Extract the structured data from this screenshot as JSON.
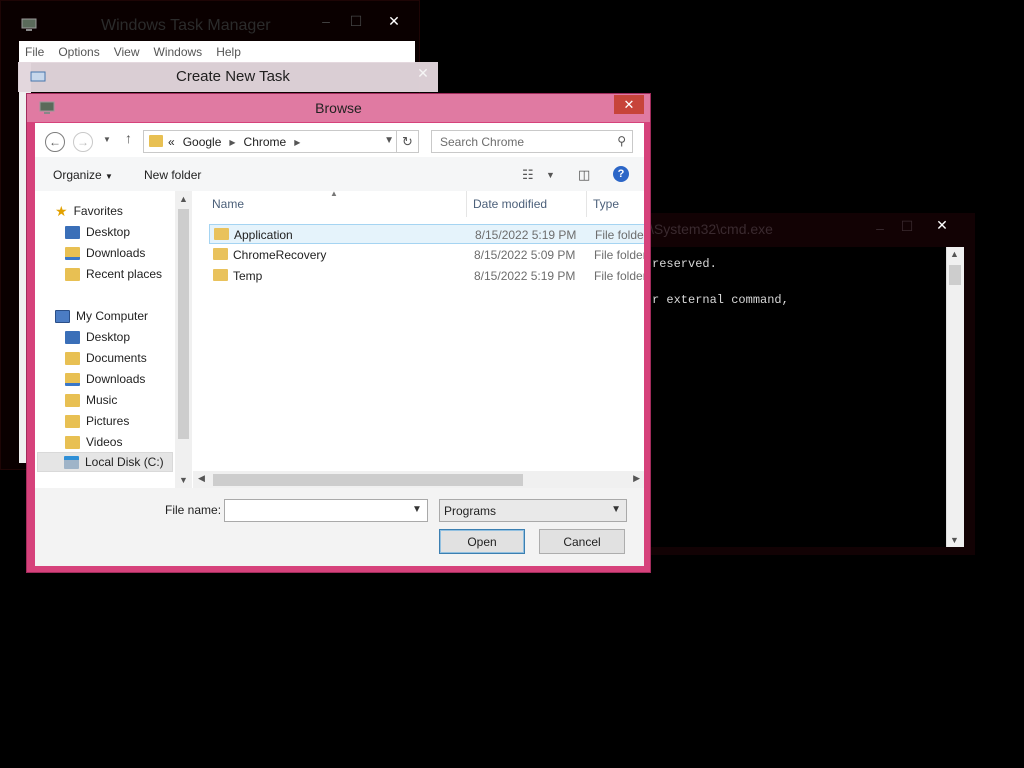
{
  "colors": {
    "browse_frame": "#d6427b",
    "browse_titlebar": "#e07aa2",
    "close_button": "#c7443a",
    "selected_row": "#e5f3fb",
    "folder": "#e9c25c"
  },
  "taskmgr": {
    "title": "Windows Task Manager",
    "menu": [
      "File",
      "Options",
      "View",
      "Windows",
      "Help"
    ]
  },
  "create_task": {
    "title": "Create New Task"
  },
  "cmd": {
    "title": "\\System32\\cmd.exe",
    "lines": [
      "reserved.",
      "",
      "r external command,"
    ]
  },
  "browse": {
    "title": "Browse",
    "close_icon": "close-icon",
    "address": {
      "overflow": "«",
      "crumbs": [
        "Google",
        "Chrome"
      ]
    },
    "search_placeholder": "Search Chrome",
    "toolbar": {
      "organize": "Organize",
      "new_folder": "New folder"
    },
    "nav": {
      "favorites": "Favorites",
      "fav_items": [
        "Desktop",
        "Downloads",
        "Recent places"
      ],
      "computer": "My Computer",
      "pc_items": [
        "Desktop",
        "Documents",
        "Downloads",
        "Music",
        "Pictures",
        "Videos",
        "Local Disk (C:)"
      ]
    },
    "columns": {
      "name": "Name",
      "date": "Date modified",
      "type": "Type"
    },
    "files": [
      {
        "name": "Application",
        "date": "8/15/2022 5:19 PM",
        "type": "File folder"
      },
      {
        "name": "ChromeRecovery",
        "date": "8/15/2022 5:09 PM",
        "type": "File folder"
      },
      {
        "name": "Temp",
        "date": "8/15/2022 5:19 PM",
        "type": "File folder"
      }
    ],
    "file_name_label": "File name:",
    "file_name_value": "",
    "file_type": "Programs",
    "open": "Open",
    "cancel": "Cancel"
  }
}
